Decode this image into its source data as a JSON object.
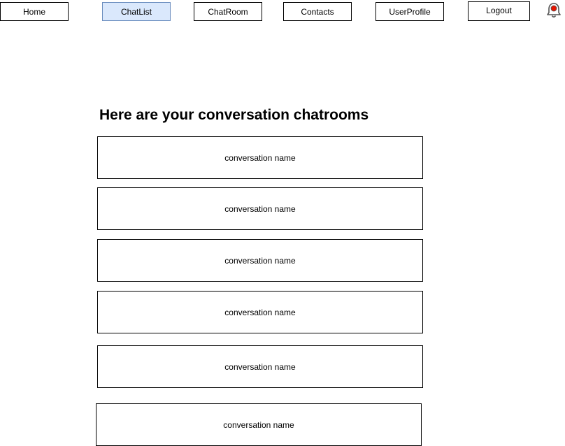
{
  "nav": {
    "items": [
      {
        "label": "Home",
        "active": false
      },
      {
        "label": "ChatList",
        "active": true
      },
      {
        "label": "ChatRoom",
        "active": false
      },
      {
        "label": "Contacts",
        "active": false
      },
      {
        "label": "UserProfile",
        "active": false
      },
      {
        "label": "Logout",
        "active": false
      }
    ],
    "active_color": "#dae8fc",
    "active_border_color": "#6c8ebf"
  },
  "notification": {
    "icon": "bell-icon",
    "badge_color": "#e51400"
  },
  "main": {
    "title": "Here are your conversation chatrooms",
    "conversations": [
      {
        "name": "conversation name"
      },
      {
        "name": "conversation name"
      },
      {
        "name": "conversation name"
      },
      {
        "name": "conversation name"
      },
      {
        "name": "conversation name"
      },
      {
        "name": "conversation name"
      }
    ]
  }
}
